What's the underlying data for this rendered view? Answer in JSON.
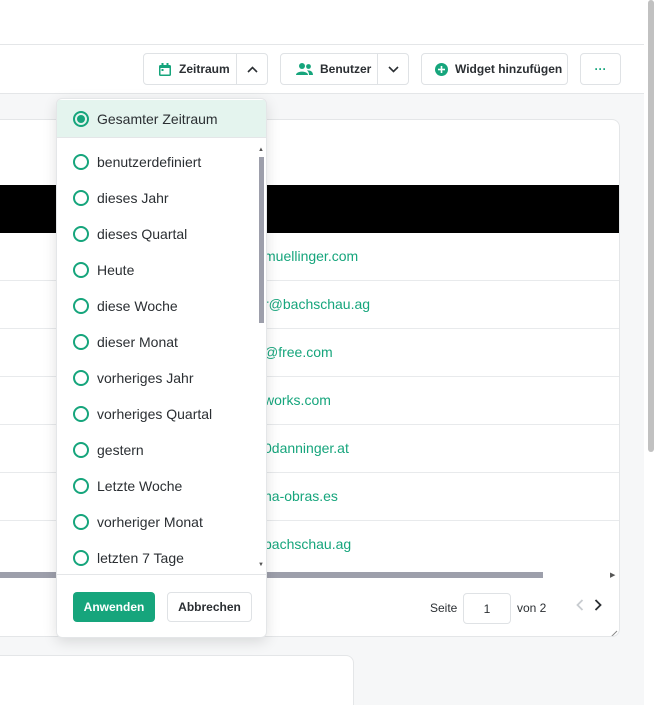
{
  "toolbar": {
    "zeitraum_label": "Zeitraum",
    "benutzer_label": "Benutzer",
    "widget_label": "Widget hinzufügen",
    "more_label": "···"
  },
  "table": {
    "rows": [
      "muellinger.com",
      "r@bachschau.ag",
      "@free.com",
      "works.com",
      "0danninger.at",
      "na-obras.es",
      "bachschau.ag"
    ]
  },
  "pagination": {
    "page_label": "Seite",
    "current_page": "1",
    "of_label": "von 2"
  },
  "dropdown": {
    "selected": "Gesamter Zeitraum",
    "options": [
      "benutzerdefiniert",
      "dieses Jahr",
      "dieses Quartal",
      "Heute",
      "diese Woche",
      "dieser Monat",
      "vorheriges Jahr",
      "vorheriges Quartal",
      "gestern",
      "Letzte Woche",
      "vorheriger Monat",
      "letzten 7 Tage"
    ],
    "apply_label": "Anwenden",
    "cancel_label": "Abbrechen"
  },
  "colors": {
    "accent": "#16a57c",
    "selected_bg": "#e4f4ee"
  }
}
